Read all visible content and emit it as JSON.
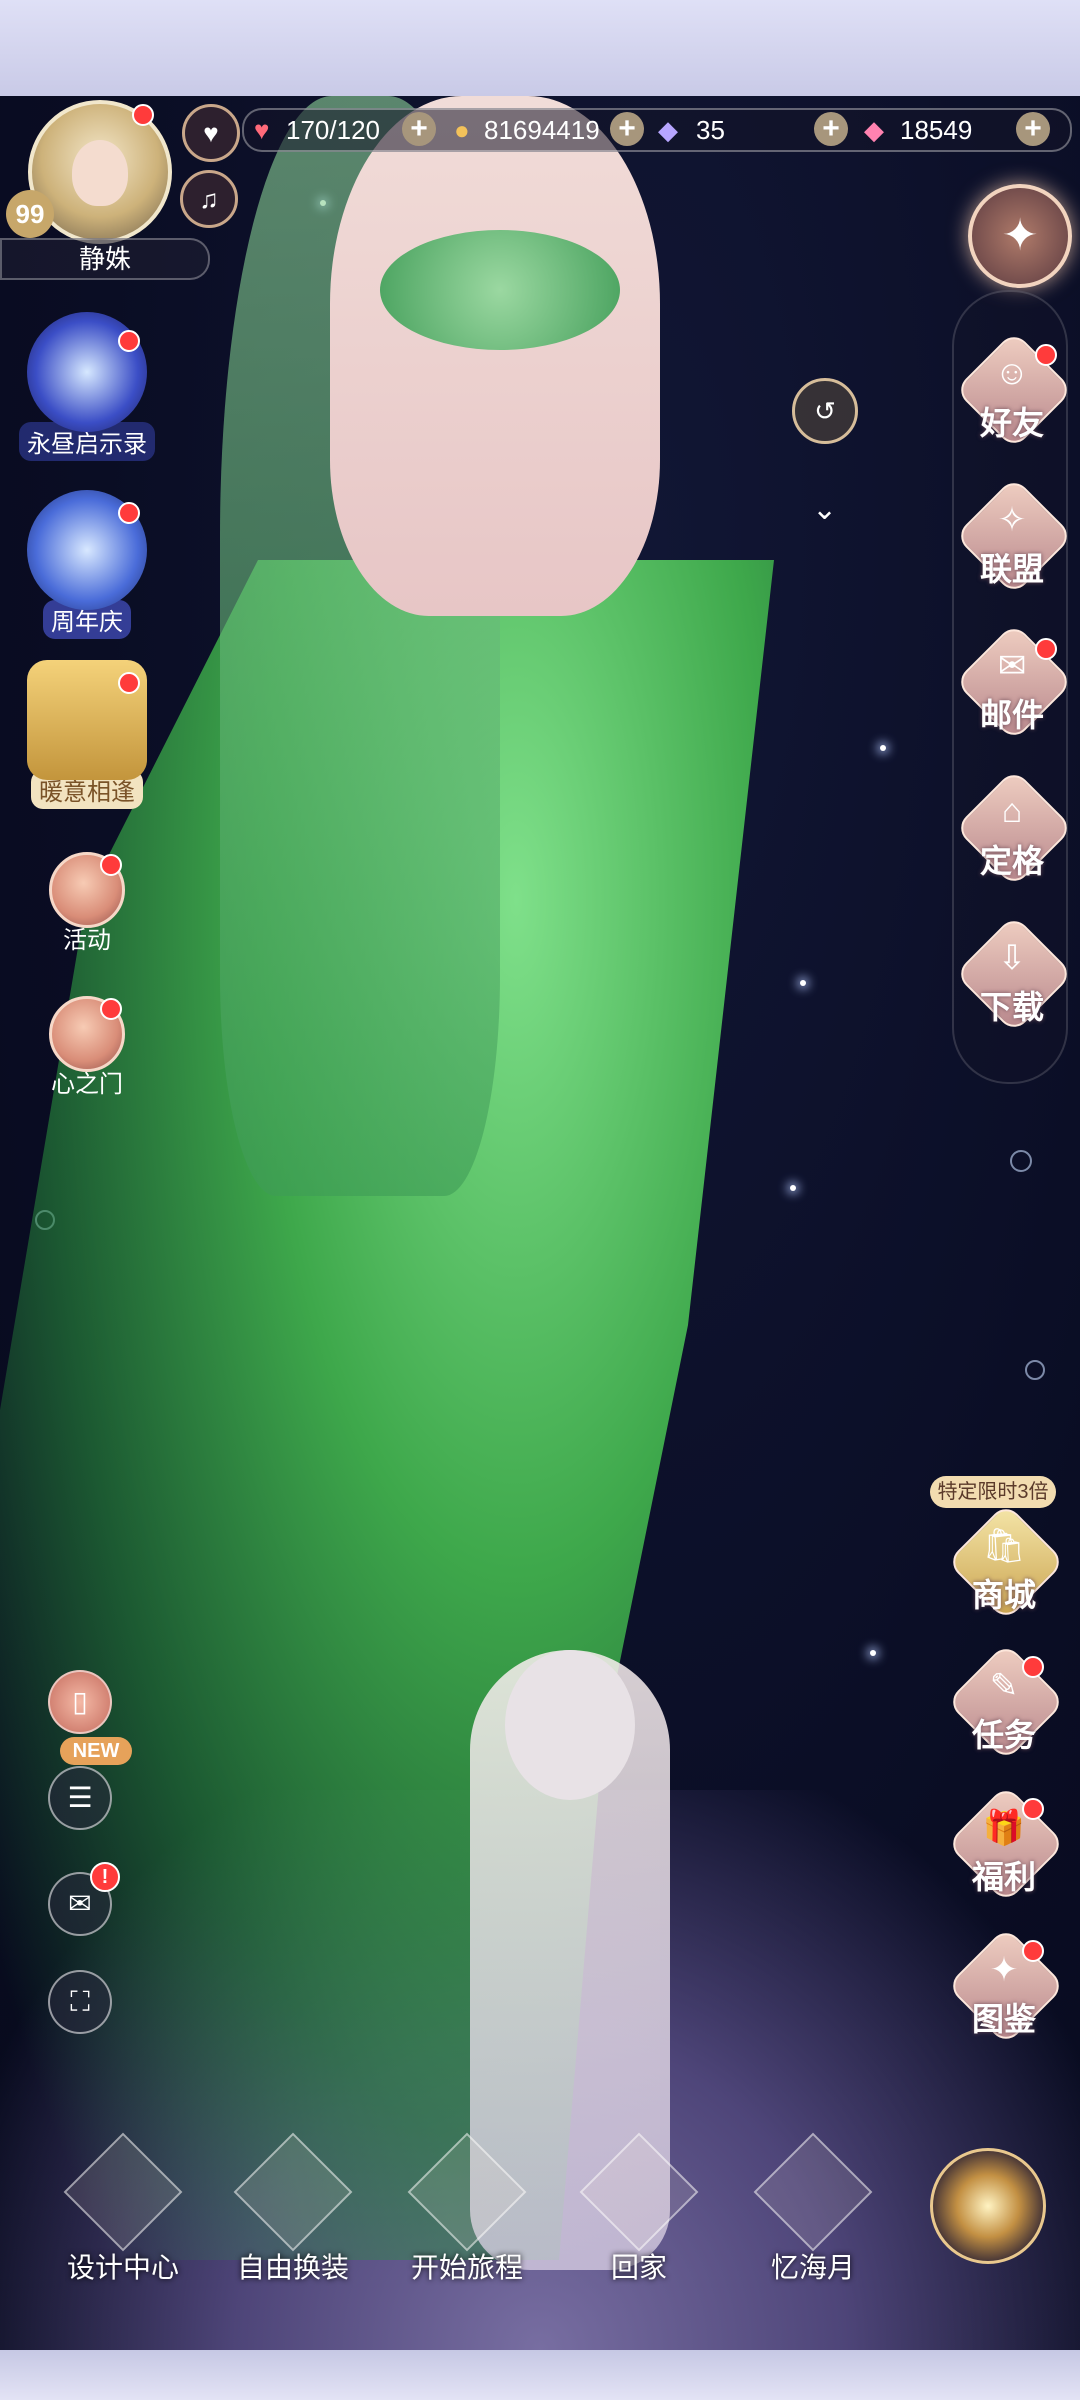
{
  "player": {
    "name": "静姝",
    "level": "99"
  },
  "resources": {
    "stamina": "170/120",
    "gold": "81694419",
    "diamonds": "35",
    "crystals": "18549"
  },
  "left_menu": [
    {
      "label": "永昼启示录"
    },
    {
      "label": "周年庆"
    },
    {
      "label": "暖意相逢"
    },
    {
      "label": "活动"
    },
    {
      "label": "心之门"
    }
  ],
  "right_menu": [
    {
      "label": "好友",
      "icon": "friends-icon"
    },
    {
      "label": "联盟",
      "icon": "alliance-icon"
    },
    {
      "label": "邮件",
      "icon": "mail-icon"
    },
    {
      "label": "定格",
      "icon": "snapshot-icon"
    },
    {
      "label": "下载",
      "icon": "download-icon"
    }
  ],
  "right_lower_menu": [
    {
      "label": "商城",
      "icon": "shop-icon"
    },
    {
      "label": "任务",
      "icon": "task-icon"
    },
    {
      "label": "福利",
      "icon": "gift-icon"
    },
    {
      "label": "图鉴",
      "icon": "collection-icon"
    }
  ],
  "shop_badge": "特定限时3倍",
  "new_tag": "NEW",
  "bottom_nav": [
    {
      "label": "设计中心"
    },
    {
      "label": "自由换装"
    },
    {
      "label": "开始旅程"
    },
    {
      "label": "回家"
    },
    {
      "label": "忆海月"
    }
  ],
  "colors": {
    "accent_red": "#ff3b3b",
    "gold": "#c7a76a",
    "menu_pink": "#f0cfc2"
  }
}
